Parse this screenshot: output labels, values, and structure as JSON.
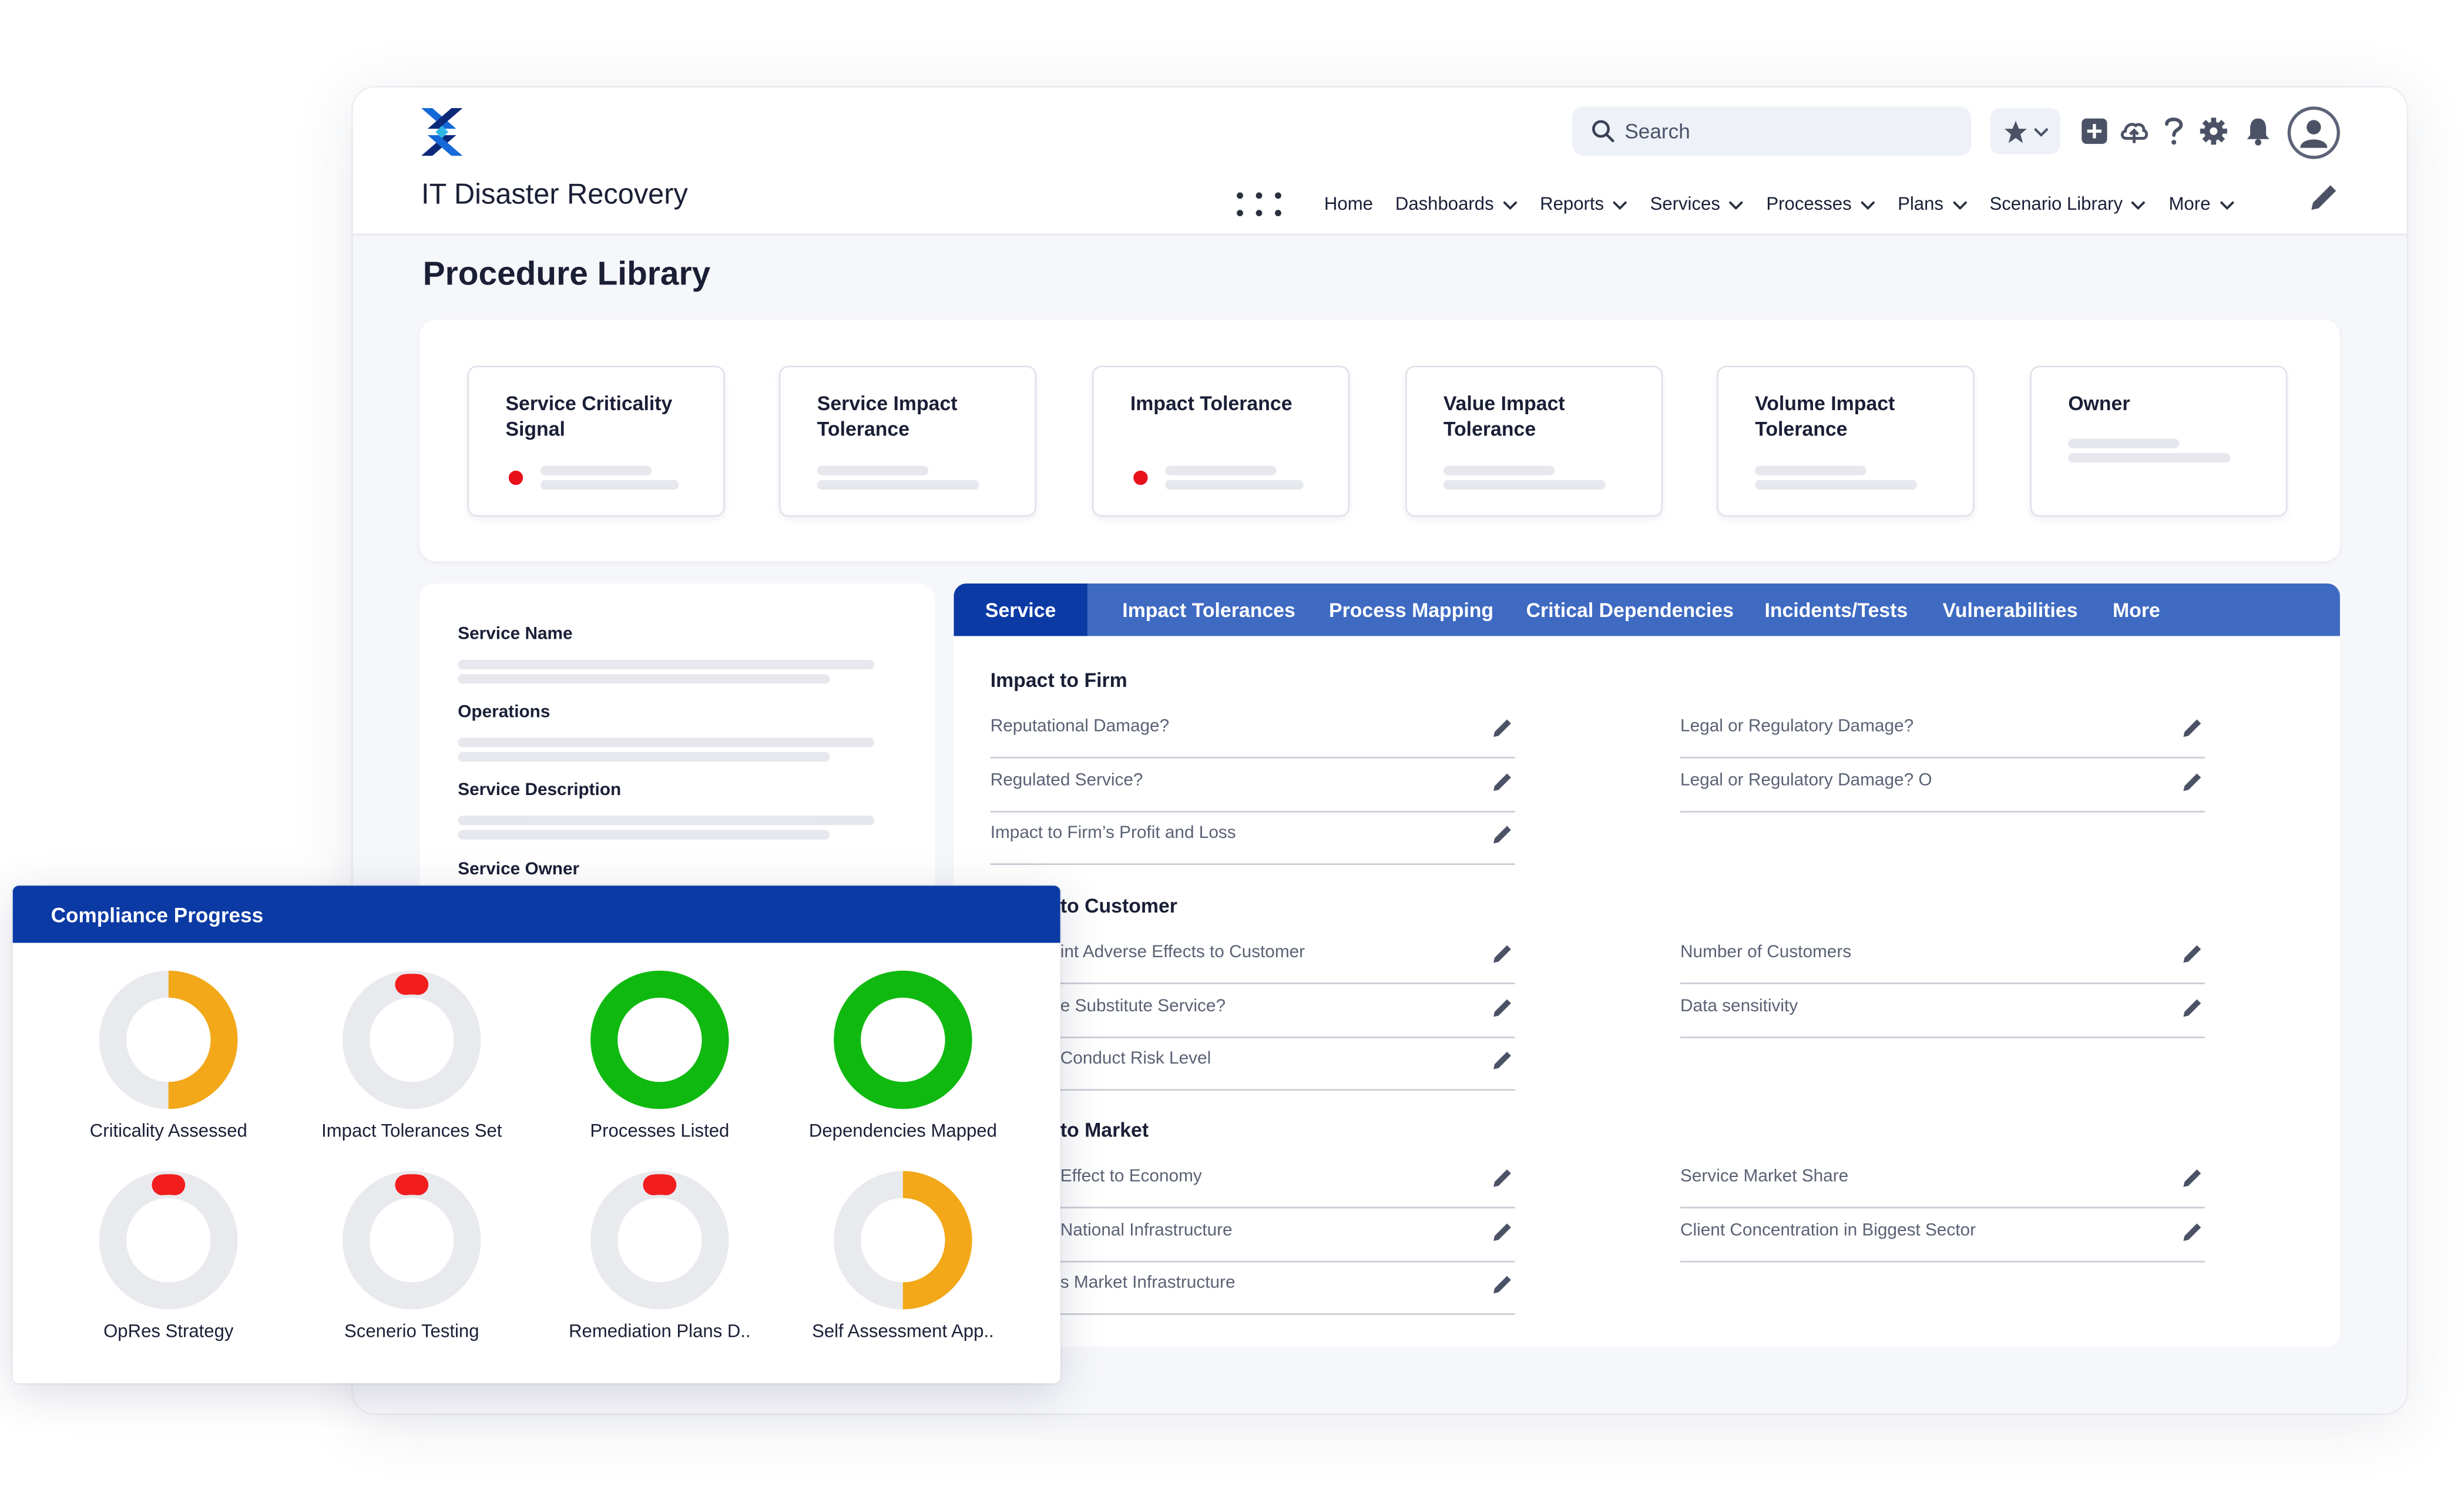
{
  "header": {
    "app_title": "IT Disaster Recovery",
    "search_placeholder": "Search",
    "nav": [
      {
        "label": "Home",
        "dropdown": false
      },
      {
        "label": "Dashboards",
        "dropdown": true
      },
      {
        "label": "Reports",
        "dropdown": true
      },
      {
        "label": "Services",
        "dropdown": true
      },
      {
        "label": "Processes",
        "dropdown": true
      },
      {
        "label": "Plans",
        "dropdown": true
      },
      {
        "label": "Scenario Library",
        "dropdown": true
      },
      {
        "label": "More",
        "dropdown": true
      }
    ],
    "icons": [
      "star-icon",
      "chevron-down-icon",
      "plus-square-icon",
      "cloud-upload-icon",
      "question-icon",
      "gear-icon",
      "bell-icon",
      "user-avatar-icon",
      "pencil-icon"
    ]
  },
  "page": {
    "title": "Procedure Library"
  },
  "summary_cards": [
    {
      "title": "Service Criticality Signal",
      "status_dot": true
    },
    {
      "title": "Service Impact Tolerance",
      "status_dot": false
    },
    {
      "title": "Impact Tolerance",
      "status_dot": true
    },
    {
      "title": "Value Impact Tolerance",
      "status_dot": false
    },
    {
      "title": "Volume Impact Tolerance",
      "status_dot": false
    },
    {
      "title": "Owner",
      "status_dot": false
    }
  ],
  "details_panel": {
    "labels": [
      "Service Name",
      "Operations",
      "Service Description",
      "Service Owner"
    ]
  },
  "tabs": [
    {
      "label": "Service",
      "active": true
    },
    {
      "label": "Impact Tolerances",
      "active": false
    },
    {
      "label": "Process Mapping",
      "active": false
    },
    {
      "label": "Critical Dependencies",
      "active": false
    },
    {
      "label": "Incidents/Tests",
      "active": false
    },
    {
      "label": "Vulnerabilities",
      "active": false
    },
    {
      "label": "More",
      "active": false
    }
  ],
  "sections": [
    {
      "title": "Impact to Firm",
      "left_fields": [
        "Reputational Damage?",
        "Regulated Service?",
        "Impact to Firm’s Profit and Loss"
      ],
      "right_fields": [
        "Legal or Regulatory Damage?",
        "Legal or Regulatory Damage? O"
      ]
    },
    {
      "title": "to Customer",
      "left_fields": [
        "int Adverse Effects to Customer",
        "e Substitute Service?",
        "Conduct Risk Level"
      ],
      "right_fields": [
        "Number of Customers",
        "Data sensitivity"
      ]
    },
    {
      "title": "to Market",
      "left_fields": [
        "Effect to Economy",
        "National Infrastructure",
        "s Market Infrastructure"
      ],
      "right_fields": [
        "Service Market Share",
        "Client Concentration in Biggest Sector"
      ]
    }
  ],
  "compliance": {
    "title": "Compliance Progress",
    "items": [
      {
        "label": "Criticality Assessed",
        "progress": 0.5,
        "color": "#f2a819"
      },
      {
        "label": "Impact Tolerances Set",
        "progress": 0.03,
        "color": "#f21d1d"
      },
      {
        "label": "Processes Listed",
        "progress": 1.0,
        "color": "#10b910"
      },
      {
        "label": "Dependencies Mapped",
        "progress": 1.0,
        "color": "#10b910"
      },
      {
        "label": "OpRes Strategy",
        "progress": 0.03,
        "color": "#f21d1d"
      },
      {
        "label": "Scenerio Testing",
        "progress": 0.03,
        "color": "#f21d1d"
      },
      {
        "label": "Remediation Plans D..",
        "progress": 0.03,
        "color": "#f21d1d"
      },
      {
        "label": "Self Assessment App..",
        "progress": 0.5,
        "color": "#f2a819"
      }
    ],
    "track_color": "#e9eaee"
  },
  "colors": {
    "primary": "#0b3aa5",
    "tab_bar": "#3e6ac2",
    "status_red": "#e8101b",
    "logo_blue": "#1569d8",
    "logo_navy": "#0d2a7a"
  }
}
